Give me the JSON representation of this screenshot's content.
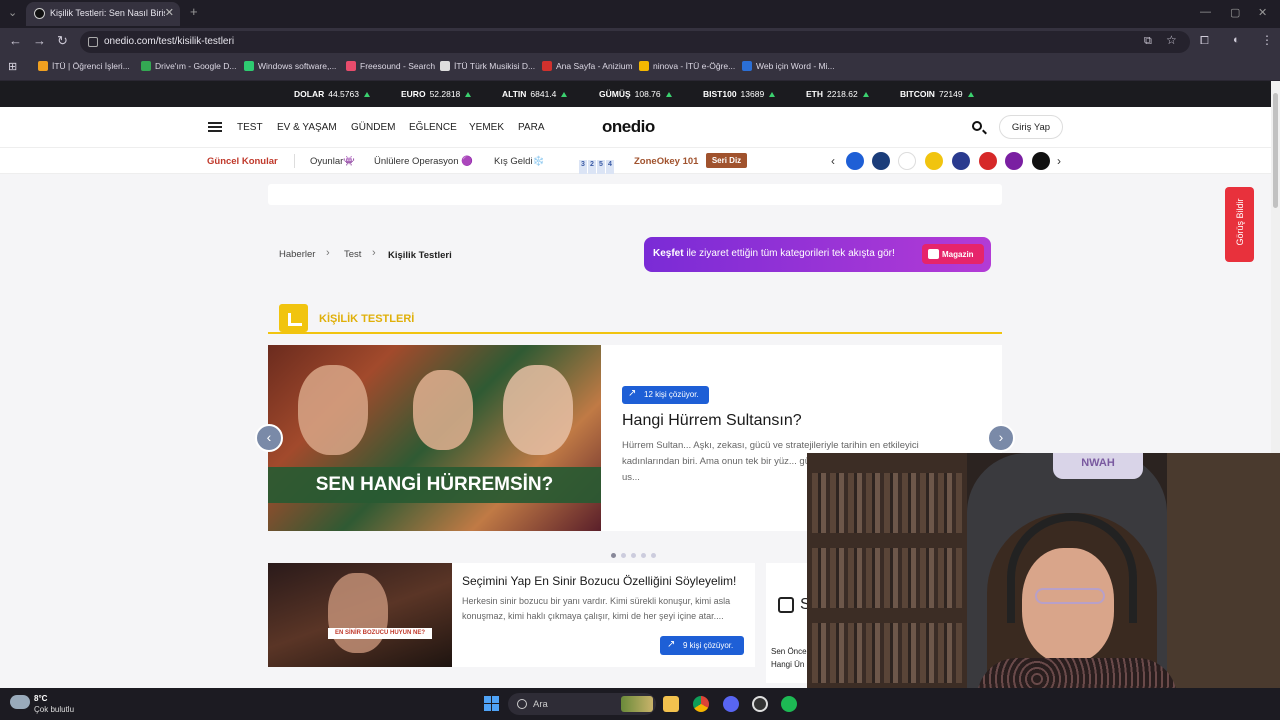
{
  "browser": {
    "tab_title": "Kişilik Testleri: Sen Nasıl Birisin?",
    "url": "onedio.com/test/kisilik-testleri",
    "bookmarks": [
      {
        "label": "İTÜ | Öğrenci İşleri...",
        "color": "#f0a020"
      },
      {
        "label": "Drive'ım - Google D...",
        "color": "#34a853"
      },
      {
        "label": "Windows software,...",
        "color": "#2ecc71"
      },
      {
        "label": "Freesound - Search",
        "color": "#e84c6c"
      },
      {
        "label": "İTÜ Türk Musikisi D...",
        "color": "#dddddd"
      },
      {
        "label": "Ana Sayfa - Anizium",
        "color": "#d0312d"
      },
      {
        "label": "ninova - İTÜ e-Öğre...",
        "color": "#f5b800"
      },
      {
        "label": "Web için Word - Mi...",
        "color": "#2b6fd6"
      }
    ]
  },
  "ticker": [
    {
      "name": "DOLAR",
      "value": "44.5763"
    },
    {
      "name": "EURO",
      "value": "52.2818"
    },
    {
      "name": "ALTIN",
      "value": "6841.4"
    },
    {
      "name": "GÜMÜŞ",
      "value": "108.76"
    },
    {
      "name": "BIST100",
      "value": "13689"
    },
    {
      "name": "ETH",
      "value": "2218.62"
    },
    {
      "name": "BITCOIN",
      "value": "72149"
    }
  ],
  "nav": {
    "links": [
      "TEST",
      "EV & YAŞAM",
      "GÜNDEM",
      "EĞLENCE",
      "YEMEK",
      "PARA"
    ],
    "logo": "onedio",
    "login": "Giriş Yap"
  },
  "topics": {
    "label": "Güncel Konular",
    "items": [
      "Oyunlar👾",
      "Ünlülere Operasyon 🟣",
      "Kış Geldi❄️"
    ],
    "zone_numbers": [
      "3",
      "2",
      "5",
      "4"
    ],
    "zone_title": "ZoneOkey 101",
    "zone_button": "Seri Diz",
    "brand_colors": [
      "#1e5fd6",
      "#1b3d7a",
      "#ffffff",
      "#f1c40f",
      "#2a3b8f",
      "#d62828",
      "#7a1fa2",
      "#111111"
    ]
  },
  "breadcrumb": [
    "Haberler",
    "Test",
    "Kişilik Testleri"
  ],
  "kesfet": {
    "bold": "Keşfet",
    "text": " ile ziyaret ettiğin tüm kategorileri tek akışta gör!",
    "button": "Magazin"
  },
  "section_title": "KİŞİLİK TESTLERİ",
  "slide": {
    "image_caption": "SEN HANGİ HÜRREMSİN?",
    "badge": "12 kişi çözüyor.",
    "title": "Hangi Hürrem Sultansın?",
    "desc": "Hürrem Sultan... Aşkı, zekası, gücü ve stratejileriyle tarihin en etkileyici kadınlarından biri. Ama onun tek bir yüz... güçlü bir anne, bazen de entrikaların us..."
  },
  "card": {
    "image_caption": "EN SİNİR BOZUCU HUYUN NE?",
    "title": "Seçimini Yap En Sinir Bozucu Özelliğini Söyleyelim!",
    "desc": "Herkesin sinir bozucu bir yanı vardır. Kimi sürekli konuşur, kimi asla konuşmaz, kimi haklı çıkmaya çalışır, kimi de her şeyi içine atar....",
    "badge": "9 kişi çözüyor."
  },
  "side_card": {
    "letter": "S",
    "text_line1": "Sen Önce",
    "text_line2": "Hangi Ün"
  },
  "feedback": "Görüş Bildir",
  "webcam": {
    "chair_text": "NWAH"
  },
  "taskbar": {
    "temp": "8°C",
    "weather": "Çok bulutlu",
    "search": "Ara"
  }
}
